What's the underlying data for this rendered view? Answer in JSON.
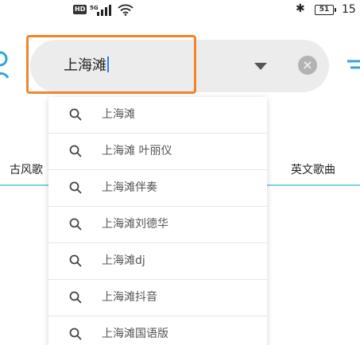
{
  "status_bar": {
    "hd_badge": "HD",
    "network": "5G",
    "clock": "15"
  },
  "search": {
    "query": "上海滩"
  },
  "tabs": {
    "left": "古风歌",
    "right": "英文歌曲"
  },
  "suggestions": [
    "上海滩",
    "上海滩 叶丽仪",
    "上海滩伴奏",
    "上海滩刘德华",
    "上海滩dj",
    "上海滩抖音",
    "上海滩国语版"
  ],
  "colors": {
    "highlight_border": "#f2842b",
    "caret": "#2b7fe6",
    "tab_underline": "#7fd3e2"
  },
  "icons": {
    "suggestion": "search-icon",
    "dropdown": "chevron-down-icon",
    "clear": "close-icon"
  }
}
